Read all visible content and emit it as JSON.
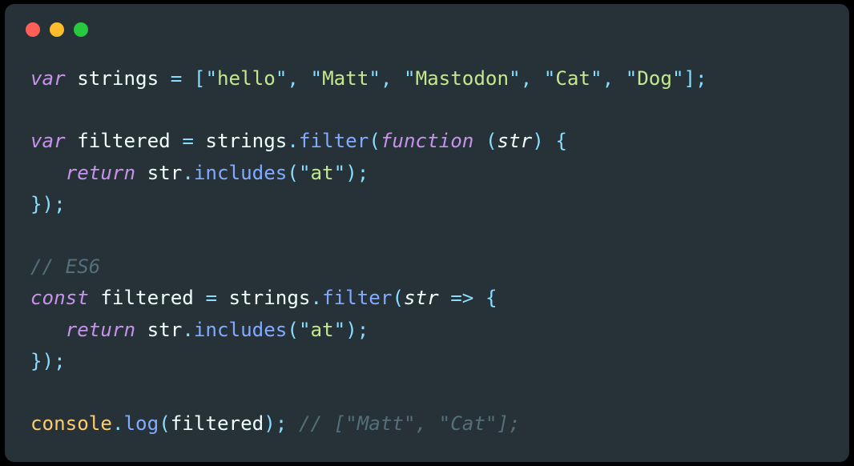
{
  "colors": {
    "background": "#263238",
    "red": "#ff5f56",
    "yellow": "#ffbd2e",
    "green": "#27c93f",
    "keyword": "#c792ea",
    "punct": "#89ddff",
    "string": "#c3e88d",
    "fn": "#82aaff",
    "comment": "#546e7a",
    "builtin": "#ffcb6b",
    "fg": "#eeffff"
  },
  "code": {
    "lines": [
      [
        {
          "t": "var ",
          "c": "kw"
        },
        {
          "t": "strings ",
          "c": "var"
        },
        {
          "t": "=",
          "c": "op"
        },
        {
          "t": " ",
          "c": "var"
        },
        {
          "t": "[",
          "c": "punct"
        },
        {
          "t": "\"",
          "c": "str-q"
        },
        {
          "t": "hello",
          "c": "str"
        },
        {
          "t": "\"",
          "c": "str-q"
        },
        {
          "t": ",",
          "c": "punct"
        },
        {
          "t": " ",
          "c": "var"
        },
        {
          "t": "\"",
          "c": "str-q"
        },
        {
          "t": "Matt",
          "c": "str"
        },
        {
          "t": "\"",
          "c": "str-q"
        },
        {
          "t": ",",
          "c": "punct"
        },
        {
          "t": " ",
          "c": "var"
        },
        {
          "t": "\"",
          "c": "str-q"
        },
        {
          "t": "Mastodon",
          "c": "str"
        },
        {
          "t": "\"",
          "c": "str-q"
        },
        {
          "t": ",",
          "c": "punct"
        },
        {
          "t": " ",
          "c": "var"
        },
        {
          "t": "\"",
          "c": "str-q"
        },
        {
          "t": "Cat",
          "c": "str"
        },
        {
          "t": "\"",
          "c": "str-q"
        },
        {
          "t": ",",
          "c": "punct"
        },
        {
          "t": " ",
          "c": "var"
        },
        {
          "t": "\"",
          "c": "str-q"
        },
        {
          "t": "Dog",
          "c": "str"
        },
        {
          "t": "\"",
          "c": "str-q"
        },
        {
          "t": "];",
          "c": "punct"
        }
      ],
      [],
      [
        {
          "t": "var ",
          "c": "kw"
        },
        {
          "t": "filtered ",
          "c": "var"
        },
        {
          "t": "=",
          "c": "op"
        },
        {
          "t": " strings",
          "c": "var"
        },
        {
          "t": ".",
          "c": "punct"
        },
        {
          "t": "filter",
          "c": "fn"
        },
        {
          "t": "(",
          "c": "punct"
        },
        {
          "t": "function ",
          "c": "kw"
        },
        {
          "t": "(",
          "c": "punct"
        },
        {
          "t": "str",
          "c": "param"
        },
        {
          "t": ")",
          "c": "punct"
        },
        {
          "t": " ",
          "c": "var"
        },
        {
          "t": "{",
          "c": "punct"
        }
      ],
      [
        {
          "t": "   ",
          "c": "var"
        },
        {
          "t": "return",
          "c": "kw"
        },
        {
          "t": " str",
          "c": "var"
        },
        {
          "t": ".",
          "c": "punct"
        },
        {
          "t": "includes",
          "c": "fn"
        },
        {
          "t": "(",
          "c": "punct"
        },
        {
          "t": "\"",
          "c": "str-q"
        },
        {
          "t": "at",
          "c": "str"
        },
        {
          "t": "\"",
          "c": "str-q"
        },
        {
          "t": ");",
          "c": "punct"
        }
      ],
      [
        {
          "t": "});",
          "c": "punct"
        }
      ],
      [],
      [
        {
          "t": "// ES6",
          "c": "comment"
        }
      ],
      [
        {
          "t": "const ",
          "c": "kw"
        },
        {
          "t": "filtered ",
          "c": "var"
        },
        {
          "t": "=",
          "c": "op"
        },
        {
          "t": " strings",
          "c": "var"
        },
        {
          "t": ".",
          "c": "punct"
        },
        {
          "t": "filter",
          "c": "fn"
        },
        {
          "t": "(",
          "c": "punct"
        },
        {
          "t": "str ",
          "c": "param"
        },
        {
          "t": "=>",
          "c": "opi"
        },
        {
          "t": " ",
          "c": "var"
        },
        {
          "t": "{",
          "c": "punct"
        }
      ],
      [
        {
          "t": "   ",
          "c": "var"
        },
        {
          "t": "return",
          "c": "kw"
        },
        {
          "t": " str",
          "c": "var"
        },
        {
          "t": ".",
          "c": "punct"
        },
        {
          "t": "includes",
          "c": "fn"
        },
        {
          "t": "(",
          "c": "punct"
        },
        {
          "t": "\"",
          "c": "str-q"
        },
        {
          "t": "at",
          "c": "str"
        },
        {
          "t": "\"",
          "c": "str-q"
        },
        {
          "t": ");",
          "c": "punct"
        }
      ],
      [
        {
          "t": "});",
          "c": "punct"
        }
      ],
      [],
      [
        {
          "t": "console",
          "c": "builtin"
        },
        {
          "t": ".",
          "c": "punct"
        },
        {
          "t": "log",
          "c": "fn"
        },
        {
          "t": "(",
          "c": "punct"
        },
        {
          "t": "filtered",
          "c": "var"
        },
        {
          "t": ");",
          "c": "punct"
        },
        {
          "t": " ",
          "c": "var"
        },
        {
          "t": "// [\"Matt\", \"Cat\"];",
          "c": "comment"
        }
      ]
    ]
  }
}
